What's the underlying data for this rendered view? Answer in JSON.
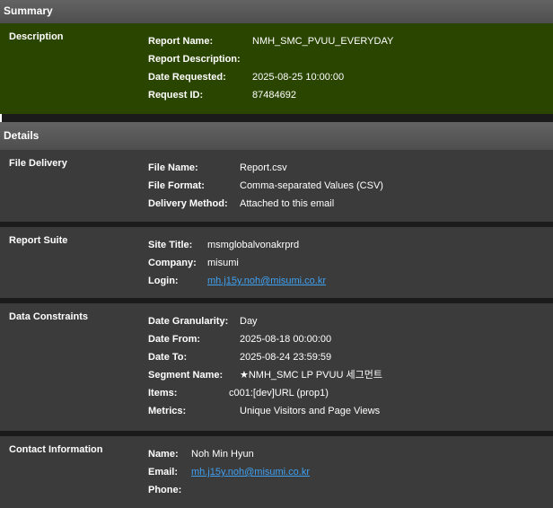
{
  "summary": {
    "title": "Summary",
    "label": "Description",
    "rows": [
      {
        "key": "Report Name:",
        "value": "NMH_SMC_PVUU_EVERYDAY"
      },
      {
        "key": "Report Description:",
        "value": ""
      },
      {
        "key": "Date Requested:",
        "value": "2025-08-25 10:00:00"
      },
      {
        "key": "Request ID:",
        "value": "87484692"
      }
    ]
  },
  "details": {
    "title": "Details",
    "file_delivery": {
      "label": "File Delivery",
      "rows": [
        {
          "key": "File Name:",
          "value": "Report.csv"
        },
        {
          "key": "File Format:",
          "value": "Comma-separated Values (CSV)"
        },
        {
          "key": "Delivery Method:",
          "value": "Attached to this email"
        }
      ]
    },
    "report_suite": {
      "label": "Report Suite",
      "rows": [
        {
          "key": "Site Title:",
          "value": "msmglobalvonakrprd"
        },
        {
          "key": "Company:",
          "value": "misumi"
        },
        {
          "key": "Login:",
          "value": "mh.j15y.noh@misumi.co.kr"
        }
      ]
    },
    "data_constraints": {
      "label": "Data Constraints",
      "rows": [
        {
          "key": "Date Granularity:",
          "value": "Day"
        },
        {
          "key": "Date From:",
          "value": "2025-08-18 00:00:00"
        },
        {
          "key": "Date To:",
          "value": "2025-08-24 23:59:59"
        },
        {
          "key": "Segment Name:",
          "value": "★NMH_SMC LP PVUU 세그먼트"
        },
        {
          "key": "Items:",
          "value": "c001:[dev]URL (prop1)"
        },
        {
          "key": "Metrics:",
          "value": "Unique Visitors and Page Views"
        }
      ]
    },
    "contact_information": {
      "label": "Contact Information",
      "rows": [
        {
          "key": "Name:",
          "value": "Noh Min Hyun"
        },
        {
          "key": "Email:",
          "value": "mh.j15y.noh@misumi.co.kr"
        },
        {
          "key": "Phone:",
          "value": ""
        }
      ]
    }
  },
  "colors": {
    "summary_background": "#2a4500",
    "section_background": "#3b3b3b",
    "header_background": "#5a5a5a",
    "link": "#3fa1f2"
  }
}
